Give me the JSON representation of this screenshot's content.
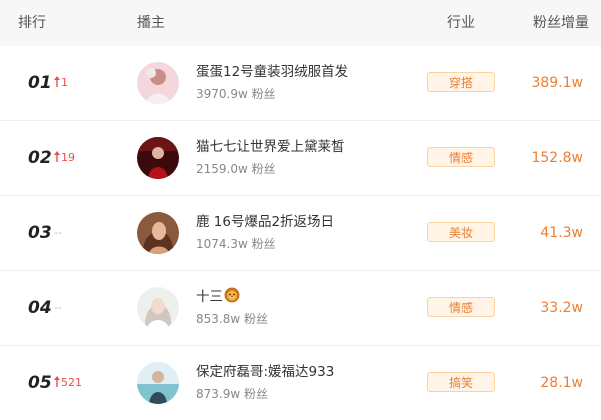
{
  "header": {
    "rank": "排行",
    "host": "播主",
    "industry": "行业",
    "gain": "粉丝增量"
  },
  "rows": [
    {
      "rank": "01",
      "trend": "1",
      "trend_direction": "up",
      "name": "蛋蛋12号童装羽绒服首发",
      "fans": "3970.9w 粉丝",
      "tag": "穿搭",
      "gain": "389.1w"
    },
    {
      "rank": "02",
      "trend": "19",
      "trend_direction": "up",
      "name": "猫七七让世界爱上黛莱皙",
      "fans": "2159.0w 粉丝",
      "tag": "情感",
      "gain": "152.8w"
    },
    {
      "rank": "03",
      "trend": "--",
      "trend_direction": "flat",
      "name": "鹿 16号爆品2折返场日",
      "fans": "1074.3w 粉丝",
      "tag": "美妆",
      "gain": "41.3w"
    },
    {
      "rank": "04",
      "trend": "--",
      "trend_direction": "flat",
      "name": "十三",
      "name_emoji": "lion-face-emoji",
      "fans": "853.8w 粉丝",
      "tag": "情感",
      "gain": "33.2w"
    },
    {
      "rank": "05",
      "trend": "521",
      "trend_direction": "up",
      "name": "保定府磊哥:媛福达933",
      "fans": "873.9w 粉丝",
      "tag": "搞笑",
      "gain": "28.1w"
    }
  ],
  "colors": {
    "trend_up": "#e94f4f",
    "trend_flat": "#bbbbbb",
    "gain": "#ee7d33",
    "tag_text": "#e7803a",
    "tag_bg": "#fff4e5",
    "tag_border": "#fbd3a3",
    "header_bg": "#f7f7f7"
  },
  "icons": {
    "trend_up": "arrow-up-icon",
    "avatar": "avatar-photo"
  }
}
